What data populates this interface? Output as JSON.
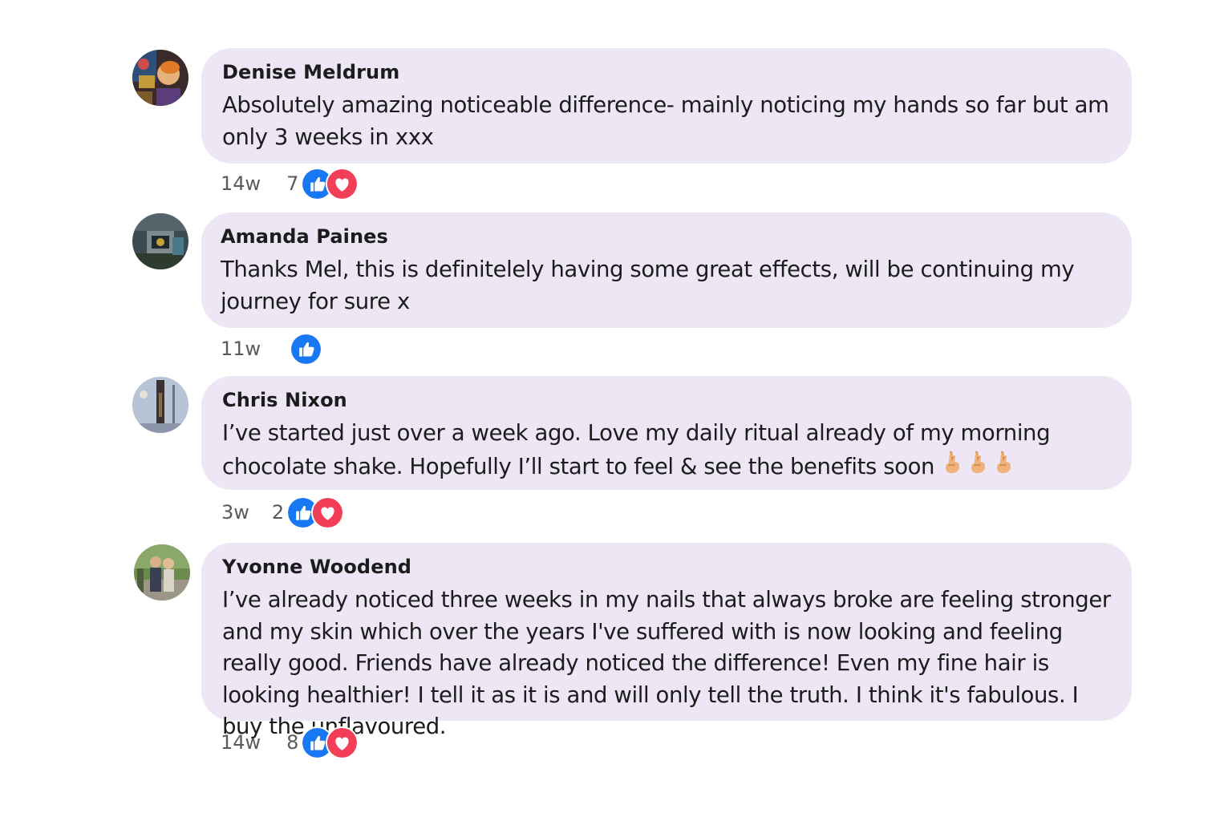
{
  "colors": {
    "bubble": "#ece6f5",
    "like": "#1877f2",
    "love": "#f33e58",
    "meta_text": "#5b5b5b"
  },
  "comments": [
    {
      "author": "Denise Meldrum",
      "text": "Absolutely amazing noticeable difference- mainly noticing my hands so far but am only 3 weeks in xxx",
      "time": "14w",
      "count": "7",
      "reactions": [
        "like-icon",
        "love-icon"
      ]
    },
    {
      "author": "Amanda Paines",
      "text": "Thanks Mel, this is definitelely having some great effects, will be continuing my journey for sure x",
      "time": "11w",
      "count": "",
      "reactions": [
        "like-icon"
      ]
    },
    {
      "author": "Chris Nixon",
      "text": "I’ve started just over a week ago. Love my daily ritual already of my morning chocolate shake. Hopefully I’ll start to feel & see the benefits soon",
      "time": "3w",
      "count": "2",
      "reactions": [
        "like-icon",
        "love-icon"
      ],
      "emoji": [
        "crossed-fingers-icon",
        "crossed-fingers-icon",
        "crossed-fingers-icon"
      ]
    },
    {
      "author": "Yvonne Woodend",
      "text": "I’ve already noticed three weeks in my nails that always broke are feeling stronger and my skin which over the years I've suffered with is now looking and feeling really good. Friends have already noticed the difference! Even my fine hair is looking healthier! I tell it as it is and will only tell the truth. I think it's fabulous. I buy the unflavoured.",
      "time": "14w",
      "count": "8",
      "reactions": [
        "like-icon",
        "love-icon"
      ]
    }
  ]
}
